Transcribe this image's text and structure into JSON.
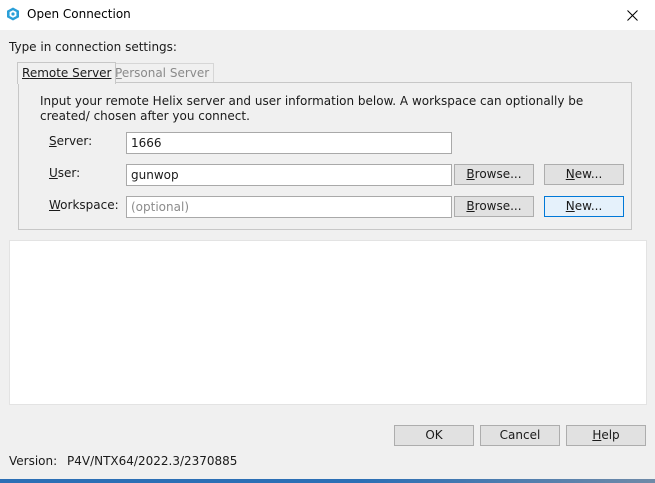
{
  "window": {
    "title": "Open Connection"
  },
  "prompt": "Type in connection settings:",
  "tabs": [
    {
      "underline": "R",
      "rest": "emote Server",
      "selected": true
    },
    {
      "underline": "P",
      "rest": "ersonal Server",
      "selected": false
    }
  ],
  "info_text": "Input your remote Helix server and user information below. A workspace can optionally be created/ chosen after you connect.",
  "fields": {
    "server": {
      "label_ul": "S",
      "label_rest": "erver:",
      "value": "1666"
    },
    "user": {
      "label_ul": "U",
      "label_rest": "ser:",
      "value": "gunwop"
    },
    "workspace": {
      "label_ul": "W",
      "label_rest": "orkspace:",
      "placeholder": "(optional)"
    }
  },
  "buttons": {
    "browse_ul": "B",
    "browse_rest": "rowse...",
    "new_ul": "N",
    "new_rest": "ew...",
    "ok": "OK",
    "cancel": "Cancel",
    "help_ul": "H",
    "help_rest": "elp"
  },
  "version": {
    "label": "Version:",
    "value": "P4V/NTX64/2022.3/2370885"
  },
  "colors": {
    "accent": "#0078d7",
    "window_bg": "#f0f0f0"
  }
}
